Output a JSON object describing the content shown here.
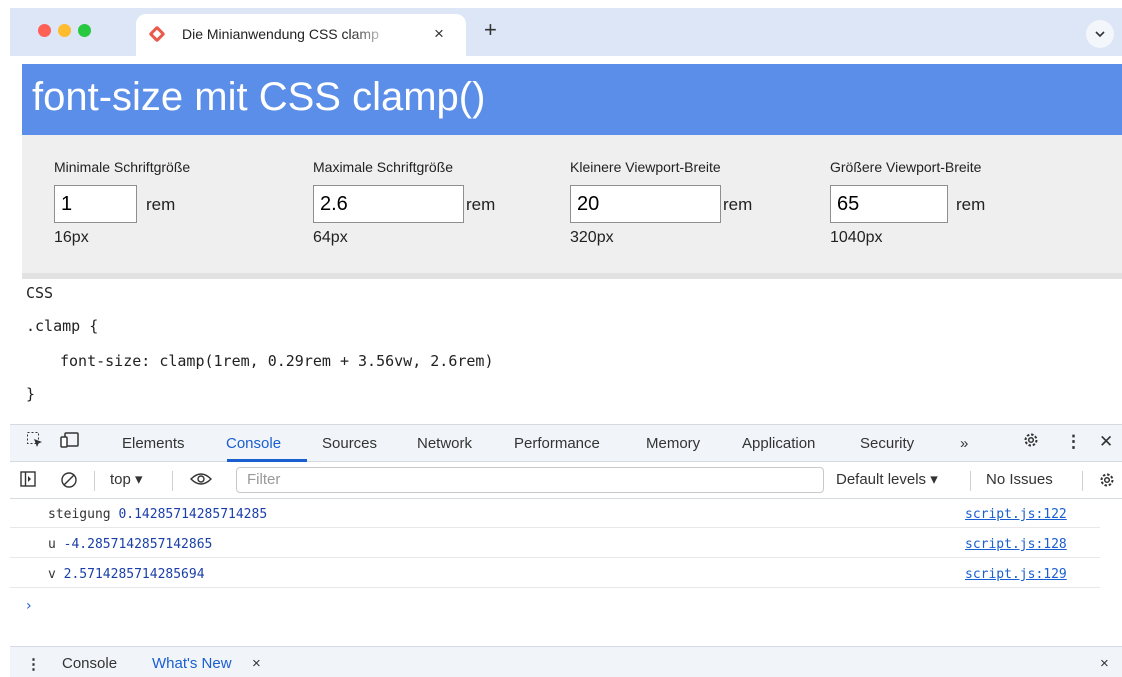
{
  "browser": {
    "tab_title": "Die Minianwendung CSS clamp",
    "tab_close": "×",
    "new_tab": "+",
    "tab_menu": "⌄",
    "traffic_colors": {
      "close": "#fe5f57",
      "minimize": "#febc2e",
      "zoom": "#28c840"
    }
  },
  "page": {
    "title": "font-size mit CSS clamp()",
    "banner_color": "#5b8ee8",
    "controls": [
      {
        "label": "Minimale Schriftgröße",
        "value": "1",
        "unit": "rem",
        "px": "16px"
      },
      {
        "label": "Maximale Schriftgröße",
        "value": "2.6",
        "unit": "rem",
        "px": "64px"
      },
      {
        "label": "Kleinere Viewport-Breite",
        "value": "20",
        "unit": "rem",
        "px": "320px"
      },
      {
        "label": "Größere Viewport-Breite",
        "value": "65",
        "unit": "rem",
        "px": "1040px"
      }
    ],
    "code": {
      "heading": "CSS",
      "selector": ".clamp {",
      "declaration": "font-size: clamp(1rem, 0.29rem + 3.56vw, 2.6rem)",
      "closing": "}"
    }
  },
  "devtools": {
    "tabs": [
      "Elements",
      "Console",
      "Sources",
      "Network",
      "Performance",
      "Memory",
      "Application",
      "Security"
    ],
    "active_tab": "Console",
    "more_tabs": "»",
    "toolbar": {
      "context": "top ▾",
      "filter_placeholder": "Filter",
      "levels": "Default levels ▾",
      "issues": "No Issues"
    },
    "console_rows": [
      {
        "label": "steigung",
        "value": "0.14285714285714285",
        "source": "script.js:122"
      },
      {
        "label": "u",
        "value": "-4.2857142857142865",
        "source": "script.js:128"
      },
      {
        "label": "v",
        "value": "2.5714285714285694",
        "source": "script.js:129"
      }
    ],
    "prompt": "›",
    "drawer": {
      "menu": "⋮",
      "console_tab": "Console",
      "whats_new_tab": "What's New",
      "whats_new_close": "×",
      "close": "×"
    },
    "accent_color": "#1a5fd0"
  }
}
